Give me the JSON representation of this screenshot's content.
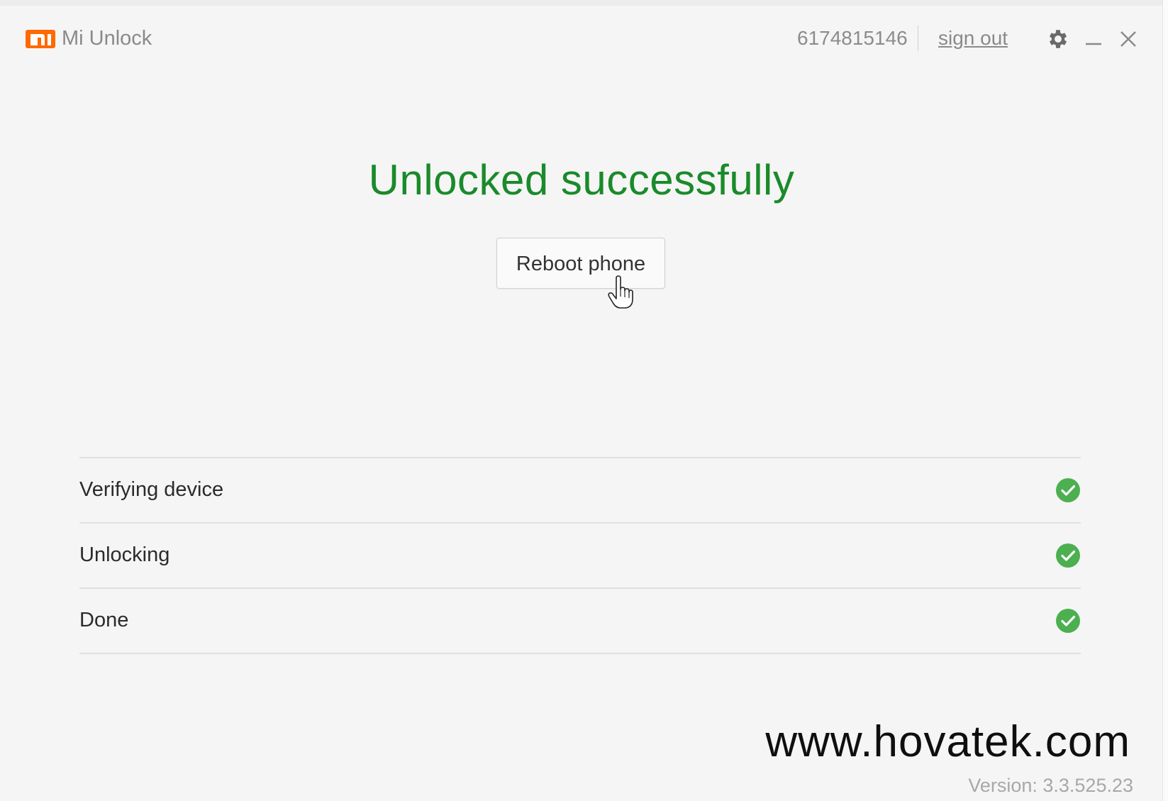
{
  "app": {
    "title": "Mi Unlock",
    "logo": "mi-logo",
    "brand_color": "#ff6900"
  },
  "header": {
    "account_id": "6174815146",
    "sign_out_label": "sign out",
    "settings_icon": "gear-icon",
    "minimize_icon": "minimize-icon",
    "close_icon": "close-icon"
  },
  "main": {
    "status_title": "Unlocked successfully",
    "status_color": "#1a8a2a",
    "reboot_label": "Reboot phone"
  },
  "steps": [
    {
      "label": "Verifying device",
      "state": "complete",
      "icon": "check-circle-icon"
    },
    {
      "label": "Unlocking",
      "state": "complete",
      "icon": "check-circle-icon"
    },
    {
      "label": "Done",
      "state": "complete",
      "icon": "check-circle-icon"
    }
  ],
  "check_color": "#4caf50",
  "footer": {
    "watermark": "www.hovatek.com",
    "version": "Version: 3.3.525.23"
  }
}
